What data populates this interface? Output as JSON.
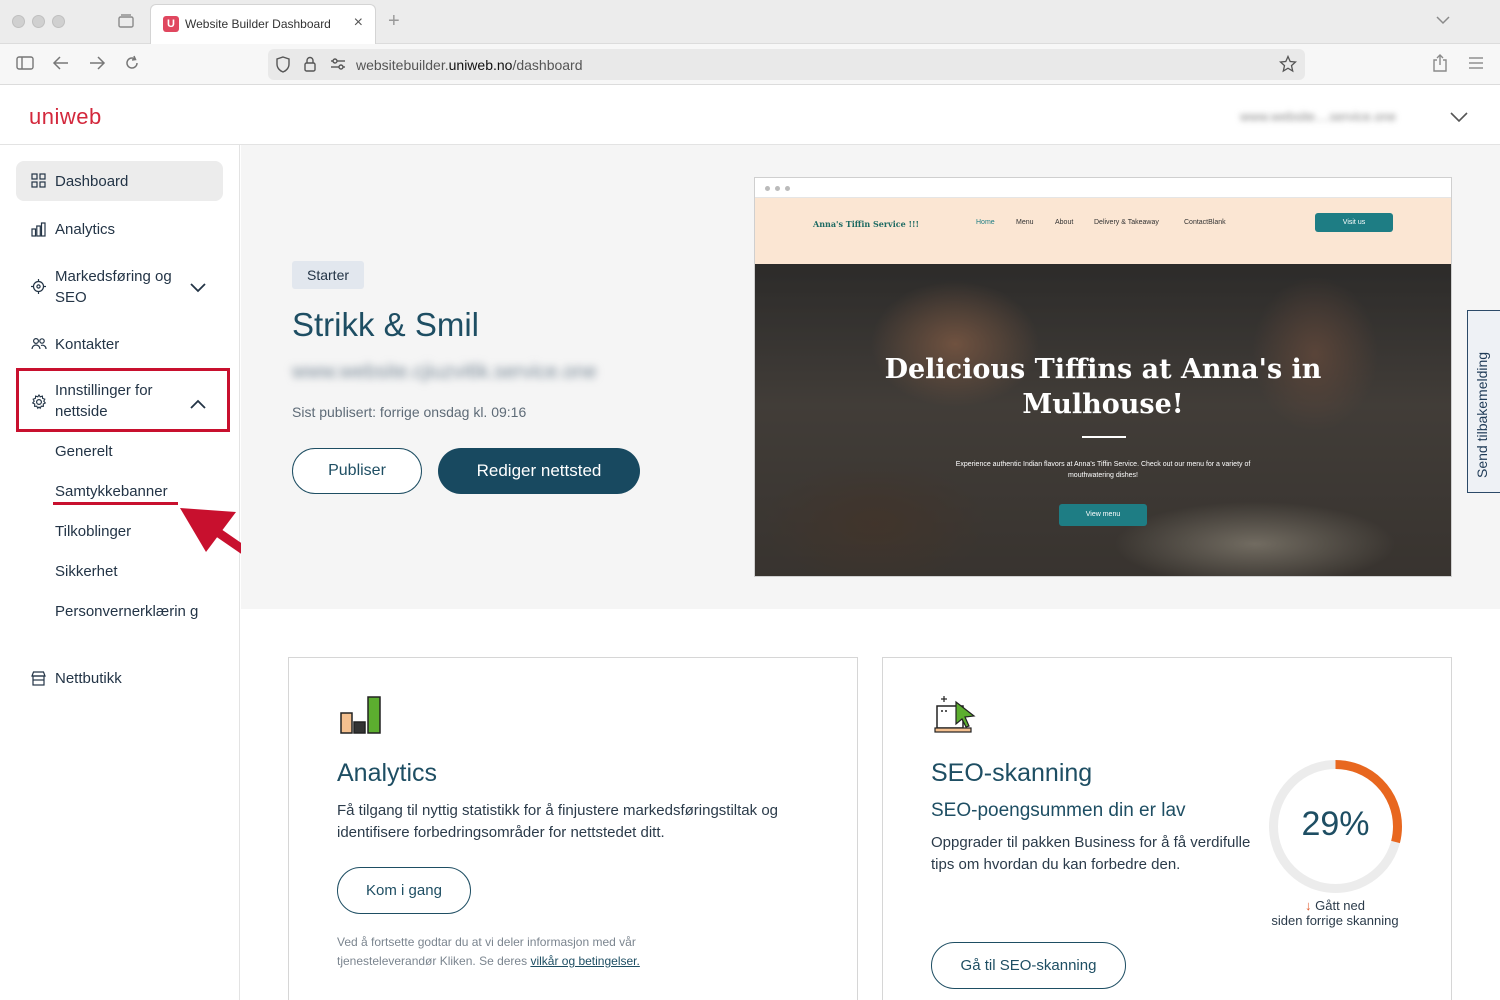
{
  "browser": {
    "tab_title": "Website Builder Dashboard",
    "tab_favicon_letter": "U",
    "url_prefix": "websitebuilder.",
    "url_domain": "uniweb.no",
    "url_path": "/dashboard"
  },
  "header": {
    "logo": "uniweb",
    "site_selector": "www.website....service.one"
  },
  "sidebar": {
    "items": [
      {
        "label": "Dashboard",
        "icon": "grid-icon"
      },
      {
        "label": "Analytics",
        "icon": "bar-chart-icon"
      },
      {
        "label": "Markedsføring og SEO",
        "icon": "target-icon"
      },
      {
        "label": "Kontakter",
        "icon": "users-icon"
      },
      {
        "label": "Innstillinger for nettside",
        "icon": "gear-icon"
      },
      {
        "label": "Nettbutikk",
        "icon": "store-icon"
      }
    ],
    "settings_sub": [
      "Generelt",
      "Samtykkebanner",
      "Tilkoblinger",
      "Sikkerhet",
      "Personvernerklærin g"
    ]
  },
  "hero": {
    "badge": "Starter",
    "site_name": "Strikk & Smil",
    "site_url": "www.website.cjiuzvi6k.service.one",
    "published": "Sist publisert: forrige onsdag kl. 09:16",
    "publish_button": "Publiser",
    "edit_button": "Rediger nettsted"
  },
  "preview": {
    "brand": "Anna's Tiffin Service !!!",
    "nav": [
      "Home",
      "Menu",
      "About",
      "Delivery & Takeaway",
      "ContactBlank"
    ],
    "visit_button": "Visit us",
    "title": "Delicious Tiffins at Anna's in Mulhouse!",
    "subtitle": "Experience authentic Indian flavors at Anna's Tiffin Service. Check out our menu for a variety of mouthwatering dishes!",
    "cta": "View menu",
    "colors": {
      "nav_bg": "#fbe6d3",
      "accent": "#1e7d84"
    }
  },
  "feedback": "Send tilbakemelding",
  "analytics_card": {
    "title": "Analytics",
    "text": "Få tilgang til nyttig statistikk for å finjustere markedsføringstiltak og identifisere forbedringsområder for nettstedet ditt.",
    "button": "Kom i gang",
    "disclaimer": "Ved å fortsette godtar du at vi deler informasjon med vår tjenesteleverandør Kliken. Se deres ",
    "disclaimer_link": "vilkår og betingelser."
  },
  "seo_card": {
    "title": "SEO-skanning",
    "subtitle": "SEO-poengsummen din er lav",
    "text": "Oppgrader til pakken Business for å få verdifulle tips om hvordan du kan forbedre den.",
    "button": "Gå til SEO-skanning",
    "score_label": "29%",
    "score_value": 29,
    "trend_line1": "Gått ned",
    "trend_line2": "siden forrige skanning",
    "gauge_color": "#e8671f"
  },
  "colors": {
    "brand": "#d3283c",
    "primary": "#184960",
    "highlight": "#c8102e"
  }
}
